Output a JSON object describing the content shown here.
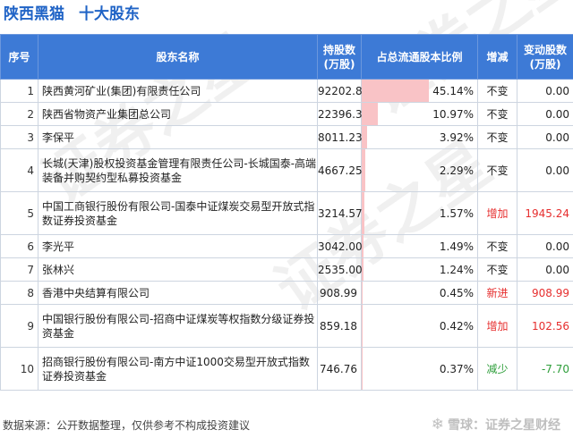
{
  "header": {
    "company": "陕西黑猫",
    "subtitle": "十大股东"
  },
  "table": {
    "columns": [
      "序号",
      "股东名称",
      "持股数\n(万股)",
      "占总流通股本比例",
      "增减",
      "变动股数\n(万股)"
    ],
    "bar_color": "#f9c3c6",
    "header_color": "#3d7ad6",
    "rows": [
      {
        "rank": "1",
        "name": "陕西黄河矿业(集团)有限责任公司",
        "shares": "92202.84",
        "pct": "45.14%",
        "pct_value": 45.14,
        "direction": "不变",
        "change": "0.00",
        "kind": "same"
      },
      {
        "rank": "2",
        "name": "陕西省物资产业集团总公司",
        "shares": "22396.38",
        "pct": "10.97%",
        "pct_value": 10.97,
        "direction": "不变",
        "change": "0.00",
        "kind": "same"
      },
      {
        "rank": "3",
        "name": "李保平",
        "shares": "8011.23",
        "pct": "3.92%",
        "pct_value": 3.92,
        "direction": "不变",
        "change": "0.00",
        "kind": "same"
      },
      {
        "rank": "4",
        "name": "长城(天津)股权投资基金管理有限责任公司-长城国泰-高端装备并购契约型私募投资基金",
        "shares": "4667.25",
        "pct": "2.29%",
        "pct_value": 2.29,
        "direction": "不变",
        "change": "0.00",
        "kind": "same"
      },
      {
        "rank": "5",
        "name": "中国工商银行股份有限公司-国泰中证煤炭交易型开放式指数证券投资基金",
        "shares": "3214.57",
        "pct": "1.57%",
        "pct_value": 1.57,
        "direction": "增加",
        "change": "1945.24",
        "kind": "up"
      },
      {
        "rank": "6",
        "name": "李光平",
        "shares": "3042.00",
        "pct": "1.49%",
        "pct_value": 1.49,
        "direction": "不变",
        "change": "0.00",
        "kind": "same"
      },
      {
        "rank": "7",
        "name": "张林兴",
        "shares": "2535.00",
        "pct": "1.24%",
        "pct_value": 1.24,
        "direction": "不变",
        "change": "0.00",
        "kind": "same"
      },
      {
        "rank": "8",
        "name": "香港中央结算有限公司",
        "shares": "908.99",
        "pct": "0.45%",
        "pct_value": 0.45,
        "direction": "新进",
        "change": "908.99",
        "kind": "new"
      },
      {
        "rank": "9",
        "name": "中国银行股份有限公司-招商中证煤炭等权指数分级证券投资基金",
        "shares": "859.18",
        "pct": "0.42%",
        "pct_value": 0.42,
        "direction": "增加",
        "change": "102.56",
        "kind": "up"
      },
      {
        "rank": "10",
        "name": "招商银行股份有限公司-南方中证1000交易型开放式指数证券投资基金",
        "shares": "746.76",
        "pct": "0.37%",
        "pct_value": 0.37,
        "direction": "减少",
        "change": "-7.70",
        "kind": "down"
      }
    ]
  },
  "footer": {
    "source": "数据来源：公开数据整理，仅供参考不构成投资建议",
    "brand": "雪球：证券之星财经",
    "brand_icon": "snowball-icon"
  },
  "watermark": {
    "text": "证券之星",
    "color": "#ececec"
  }
}
